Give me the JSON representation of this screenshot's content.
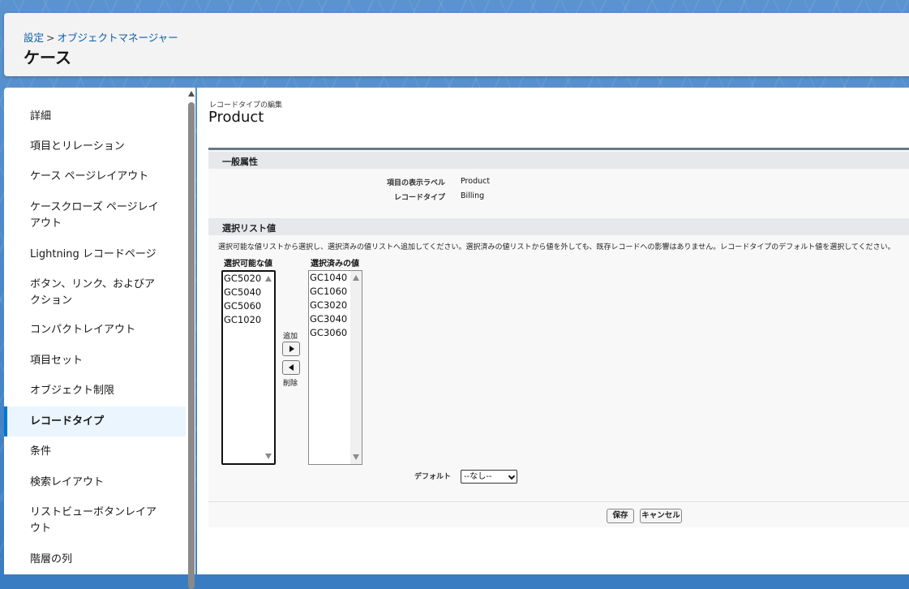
{
  "header": {
    "breadcrumb": {
      "setup": "設定",
      "separator": ">",
      "object_manager": "オブジェクトマネージャー"
    },
    "title": "ケース"
  },
  "sidebar": {
    "items": [
      {
        "label": "詳細"
      },
      {
        "label": "項目とリレーション"
      },
      {
        "label": "ケース ページレイアウト"
      },
      {
        "label": "ケースクローズ ページレイアウト"
      },
      {
        "label": "Lightning レコードページ"
      },
      {
        "label": "ボタン、リンク、およびアクション"
      },
      {
        "label": "コンパクトレイアウト"
      },
      {
        "label": "項目セット"
      },
      {
        "label": "オブジェクト制限"
      },
      {
        "label": "レコードタイプ",
        "active": true
      },
      {
        "label": "条件"
      },
      {
        "label": "検索レイアウト"
      },
      {
        "label": "リストビューボタンレイアウト"
      },
      {
        "label": "階層の列"
      }
    ]
  },
  "main": {
    "subtitle": "レコードタイプの編集",
    "title": "Product",
    "general_section": {
      "heading": "一般属性",
      "fields": [
        {
          "label": "項目の表示ラベル",
          "value": "Product"
        },
        {
          "label": "レコードタイプ",
          "value": "Billing"
        }
      ]
    },
    "picklist_section": {
      "heading": "選択リスト値",
      "description": "選択可能な値リストから選択し、選択済みの値リストへ追加してください。選択済みの値リストから値を外しても、既存レコードへの影響はありません。レコードタイプのデフォルト値を選択してください。",
      "available_label": "選択可能な値",
      "selected_label": "選択済みの値",
      "available_values": [
        "GC5020",
        "GC5040",
        "GC5060",
        "GC1020"
      ],
      "selected_values": [
        "GC1040",
        "GC1060",
        "GC3020",
        "GC3040",
        "GC3060"
      ],
      "add_label": "追加",
      "remove_label": "削除",
      "default_label": "デフォルト",
      "default_value": "--なし--"
    },
    "buttons": {
      "save": "保存",
      "cancel": "キャンセル"
    }
  }
}
